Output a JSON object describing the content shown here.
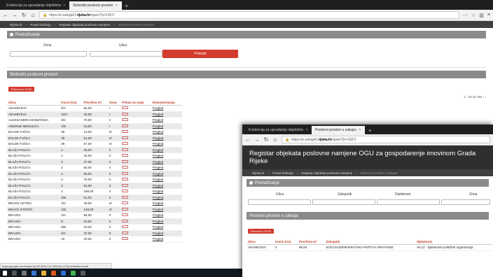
{
  "win1": {
    "tabs": [
      {
        "label": "Evidencija za upravljanje objektima"
      },
      {
        "label": "Slobodni poslovni prostori"
      }
    ],
    "url": {
      "prefix": "https://e-",
      "domain": "rijeka.hr",
      "path": "/spec/?p=1307/",
      "full_before": "https://e-uslugeO.",
      "full_domain": "rijeka.hr",
      "full_after": "/spec/?p=1307/"
    },
    "breadcrumbs": [
      "Rijeka.hr",
      "Portal služenja",
      "Registar objekata poslovne namjene",
      "Slobodni poslovni prostori"
    ],
    "search_title": "Pretraživanje",
    "filters": {
      "zona_label": "Zona",
      "ulica_label": "Ulica",
      "search_button": "Pretraži"
    },
    "results_title": "Slobodni poslovni prostori",
    "export_label": "Preuzmi u XLSX",
    "pager": "1 - 25 od 192",
    "columns": [
      "Ulica",
      "Kućni broj",
      "Površina m²",
      "Zona",
      "Prikaz na mapi",
      "Dokumentacija"
    ],
    "rows": [
      [
        "ADAMIĆEVA",
        "5/A",
        "82,00",
        "I",
        "Pregled"
      ],
      [
        "ADAMIĆEVA",
        "34/A",
        "30,00",
        "I",
        "Pregled"
      ],
      [
        "ALESSANDRA MANZONIJA",
        "5/C",
        "70,00",
        "II",
        "Pregled"
      ],
      [
        "ANDRIJE MEDULIĆA",
        "1/B",
        "10,00",
        "I",
        "Pregled"
      ],
      [
        "BALDE FUČKA",
        "39",
        "13,00",
        "III",
        "Pregled"
      ],
      [
        "BALDE FUČKA",
        "39",
        "61,00",
        "III",
        "Pregled"
      ],
      [
        "BALDE FUČKA",
        "39",
        "67,00",
        "III",
        "Pregled"
      ],
      [
        "BLAŽA POLIĆA",
        "2",
        "26,00",
        "II",
        "Pregled"
      ],
      [
        "BLAŽA POLIĆA",
        "2",
        "34,00",
        "II",
        "Pregled"
      ],
      [
        "BLAŽA POLIĆA",
        "2",
        "37,00",
        "II",
        "Pregled"
      ],
      [
        "BLAŽA POLIĆA",
        "2",
        "50,00",
        "II",
        "Pregled"
      ],
      [
        "BLAŽA POLIĆA",
        "2",
        "60,00",
        "II",
        "Pregled"
      ],
      [
        "BLAŽA POLIĆA",
        "2",
        "76,00",
        "II",
        "Pregled"
      ],
      [
        "BLAŽA POLIĆA",
        "2",
        "81,00",
        "II",
        "Pregled"
      ],
      [
        "BLAŽA POLIĆA",
        "2",
        "338,00",
        "II",
        "Pregled"
      ],
      [
        "BLAŽA POLIĆA",
        "5/B",
        "61,00",
        "II",
        "Pregled"
      ],
      [
        "BRAĆE CETINA",
        "2/C",
        "29,00",
        "III",
        "Pregled"
      ],
      [
        "BRAĆE STIPČIĆ",
        "1/B",
        "148,00",
        "III",
        "Pregled"
      ],
      [
        "BRAJDA",
        "2/A",
        "95,00",
        "II",
        "Pregled"
      ],
      [
        "BRAJDA",
        "8",
        "40,00",
        "II",
        "Pregled"
      ],
      [
        "BRAJDA",
        "8/B",
        "20,00",
        "II",
        "Pregled"
      ],
      [
        "BRAJDA",
        "9/A",
        "37,00",
        "II",
        "Pregled"
      ],
      [
        "BRAJDA",
        "10",
        "20,00",
        "II",
        "Pregled"
      ]
    ],
    "statusbar": "maps.google.com/maps?q=45.3231+14.4431&z=17&t=m&iwloc=near"
  },
  "win2": {
    "tabs": [
      {
        "label": "Evidencija za upravljanje objektima"
      },
      {
        "label": "Poslovni prostori u zakupu"
      }
    ],
    "url": {
      "before": "https://e-usluge0.",
      "domain": "rijeka.hr",
      "after": "/spec/?p=1307/"
    },
    "page_title": "Registar objekata poslovne namjene OGU za gospodarenje imovinom Grada Rijeke",
    "breadcrumbs": [
      "Rijeka.hr",
      "Portal služenja",
      "Registar objekata poslovne namjene",
      "Poslovni prostori u zakupu"
    ],
    "search_title": "Pretraživanje",
    "filters": [
      "Ulica",
      "Zakupnik",
      "Djelatnost",
      "Zona"
    ],
    "results_title": "Poslovni prostori u zakupu",
    "export_label": "Preuzmi u XLSX",
    "columns": [
      "Ulica",
      "Kućni broj",
      "Površina m²",
      "Zakupnik",
      "Djelatnost"
    ],
    "rows": [
      [
        "ADAMIĆEVA",
        "4",
        "99,00",
        "SOCIJALDEMOKRATSKA PARTIJA HRVATSKE",
        "94.12 - Djelatnosti političkih organizacija"
      ]
    ]
  },
  "colors": {
    "accent_red": "#d33b2f",
    "header_gray": "#8a8a8a",
    "dark_header": "#2f2f2f"
  }
}
